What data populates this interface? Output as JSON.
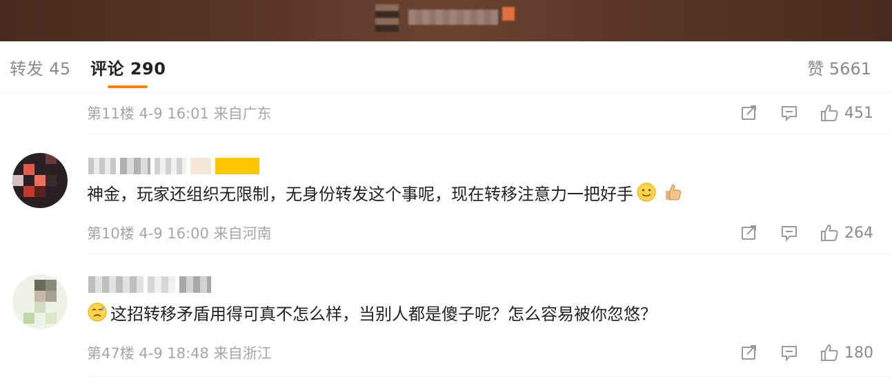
{
  "tabs": {
    "repost_label": "转发 45",
    "comment_label": "评论 290",
    "likes_label": "赞 5661"
  },
  "colors": {
    "accent": "#ff8200",
    "header_bg": "#5b3628",
    "muted_text": "#a6a6a6"
  },
  "comments": [
    {
      "meta": "第11楼 4-9 16:01 来自广东",
      "likes": "451"
    },
    {
      "text": "神金，玩家还组织无限制，无身份转发这个事呢，现在转移注意力一把好手",
      "trailing_emojis": [
        "smile-emoji",
        "thumbs-up-emoji"
      ],
      "meta": "第10楼 4-9 16:00 来自河南",
      "likes": "264"
    },
    {
      "leading_emoji": "sweat-emoji",
      "text": "这招转移矛盾用得可真不怎么样，当别人都是傻子呢？怎么容易被你忽悠？",
      "meta": "第47楼 4-9 18:48 来自浙江",
      "likes": "180"
    }
  ],
  "icons": {
    "repost": "repost-icon",
    "comment": "comment-icon",
    "like": "thumbs-up-icon"
  }
}
